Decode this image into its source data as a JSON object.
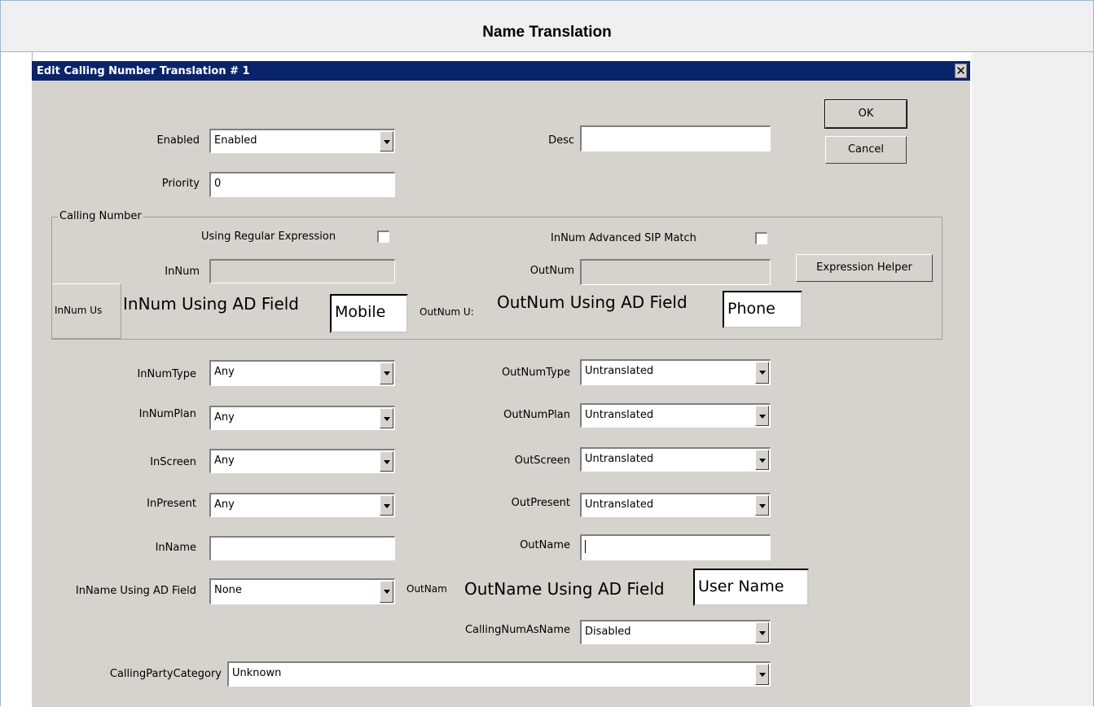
{
  "page": {
    "title": "Name Translation"
  },
  "dialog": {
    "title": "Edit Calling Number Translation # 1",
    "close_glyph": "✕",
    "ok_label": "OK",
    "cancel_label": "Cancel",
    "expression_helper_label": "Expression Helper"
  },
  "fields": {
    "enabled": {
      "label": "Enabled",
      "value": "Enabled"
    },
    "desc": {
      "label": "Desc",
      "value": ""
    },
    "priority": {
      "label": "Priority",
      "value": "0"
    },
    "calling_number_group": "Calling Number",
    "using_regex": {
      "label": "Using Regular Expression",
      "checked": false
    },
    "innum_adv_sip": {
      "label": "InNum Advanced SIP Match",
      "checked": false
    },
    "innum": {
      "label": "InNum",
      "value": ""
    },
    "outnum": {
      "label": "OutNum",
      "value": ""
    },
    "innum_ad_small": "InNum Us",
    "innum_ad_big": "InNum Using AD Field",
    "innum_ad_value": "Mobile",
    "outnum_ad_small": "OutNum U:",
    "outnum_ad_big": "OutNum Using AD Field",
    "outnum_ad_value": "Phone",
    "innumtype": {
      "label": "InNumType",
      "value": "Any"
    },
    "outnumtype": {
      "label": "OutNumType",
      "value": "Untranslated"
    },
    "innumplan": {
      "label": "InNumPlan",
      "value": "Any"
    },
    "outnumplan": {
      "label": "OutNumPlan",
      "value": "Untranslated"
    },
    "inscreen": {
      "label": "InScreen",
      "value": "Any"
    },
    "outscreen": {
      "label": "OutScreen",
      "value": "Untranslated"
    },
    "inpresent": {
      "label": "InPresent",
      "value": "Any"
    },
    "outpresent": {
      "label": "OutPresent",
      "value": "Untranslated"
    },
    "inname": {
      "label": "InName",
      "value": ""
    },
    "outname": {
      "label": "OutName",
      "value": ""
    },
    "inname_ad": {
      "label": "InName Using AD Field",
      "value": "None"
    },
    "outname_ad_small": "OutNam",
    "outname_ad_big": "OutName Using AD Field",
    "outname_ad_value": "User Name",
    "callingnumasname": {
      "label": "CallingNumAsName",
      "value": "Disabled"
    },
    "callingpartycategory": {
      "label": "CallingPartyCategory",
      "value": "Unknown"
    }
  }
}
